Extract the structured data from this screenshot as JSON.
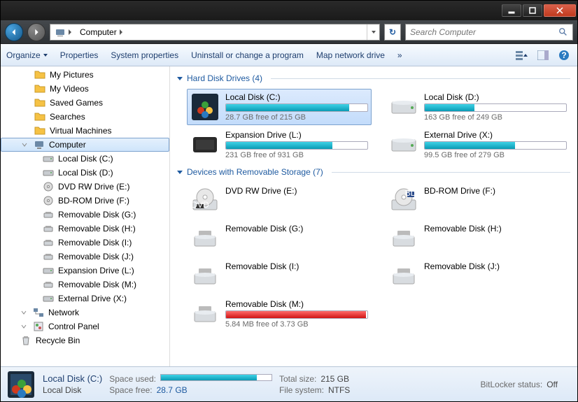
{
  "window": {
    "title": ""
  },
  "nav": {
    "address_segments": [
      "Computer"
    ],
    "search_placeholder": "Search Computer"
  },
  "toolbar": {
    "organize": "Organize",
    "properties": "Properties",
    "system_properties": "System properties",
    "uninstall": "Uninstall or change a program",
    "map_drive": "Map network drive",
    "overflow": "»"
  },
  "sidebar": {
    "items": [
      {
        "label": "My Pictures",
        "indent": 48,
        "icon": "folder"
      },
      {
        "label": "My Videos",
        "indent": 48,
        "icon": "folder"
      },
      {
        "label": "Saved Games",
        "indent": 48,
        "icon": "folder"
      },
      {
        "label": "Searches",
        "indent": 48,
        "icon": "folder"
      },
      {
        "label": "Virtual Machines",
        "indent": 48,
        "icon": "folder"
      },
      {
        "label": "Computer",
        "indent": 28,
        "icon": "computer",
        "selected": true,
        "expandable": true
      },
      {
        "label": "Local Disk (C:)",
        "indent": 60,
        "icon": "hdd"
      },
      {
        "label": "Local Disk (D:)",
        "indent": 60,
        "icon": "hdd"
      },
      {
        "label": "DVD RW Drive (E:)",
        "indent": 60,
        "icon": "optical"
      },
      {
        "label": "BD-ROM Drive (F:)",
        "indent": 60,
        "icon": "optical"
      },
      {
        "label": "Removable Disk (G:)",
        "indent": 60,
        "icon": "removable"
      },
      {
        "label": "Removable Disk (H:)",
        "indent": 60,
        "icon": "removable"
      },
      {
        "label": "Removable Disk (I:)",
        "indent": 60,
        "icon": "removable"
      },
      {
        "label": "Removable Disk (J:)",
        "indent": 60,
        "icon": "removable"
      },
      {
        "label": "Expansion Drive (L:)",
        "indent": 60,
        "icon": "hdd"
      },
      {
        "label": "Removable Disk (M:)",
        "indent": 60,
        "icon": "removable"
      },
      {
        "label": "External Drive (X:)",
        "indent": 60,
        "icon": "hdd"
      },
      {
        "label": "Network",
        "indent": 28,
        "icon": "network",
        "expandable": true
      },
      {
        "label": "Control Panel",
        "indent": 28,
        "icon": "cpanel",
        "expandable": true
      },
      {
        "label": "Recycle Bin",
        "indent": 28,
        "icon": "recycle"
      }
    ]
  },
  "groups": [
    {
      "header": "Hard Disk Drives (4)",
      "drives": [
        {
          "name": "Local Disk (C:)",
          "free": "28.7 GB free of 215 GB",
          "pct": 87,
          "color": "blue",
          "icon": "win",
          "selected": true
        },
        {
          "name": "Local Disk (D:)",
          "free": "163 GB free of 249 GB",
          "pct": 35,
          "color": "blue",
          "icon": "hdd"
        },
        {
          "name": "Expansion Drive (L:)",
          "free": "231 GB free of 931 GB",
          "pct": 75,
          "color": "blue",
          "icon": "ext"
        },
        {
          "name": "External Drive (X:)",
          "free": "99.5 GB free of 279 GB",
          "pct": 64,
          "color": "blue",
          "icon": "hdd"
        }
      ]
    },
    {
      "header": "Devices with Removable Storage (7)",
      "drives": [
        {
          "name": "DVD RW Drive (E:)",
          "icon": "dvd"
        },
        {
          "name": "BD-ROM Drive (F:)",
          "icon": "bd"
        },
        {
          "name": "Removable Disk (G:)",
          "icon": "rem"
        },
        {
          "name": "Removable Disk (H:)",
          "icon": "rem"
        },
        {
          "name": "Removable Disk (I:)",
          "icon": "rem"
        },
        {
          "name": "Removable Disk (J:)",
          "icon": "rem"
        },
        {
          "name": "Removable Disk (M:)",
          "free": "5.84 MB free of 3.73 GB",
          "pct": 99,
          "color": "red",
          "icon": "rem"
        }
      ]
    }
  ],
  "details": {
    "title": "Local Disk (C:)",
    "subtitle": "Local Disk",
    "space_used_label": "Space used:",
    "space_free_label": "Space free:",
    "space_free_value": "28.7 GB",
    "total_size_label": "Total size:",
    "total_size_value": "215 GB",
    "filesystem_label": "File system:",
    "filesystem_value": "NTFS",
    "bitlocker_label": "BitLocker status:",
    "bitlocker_value": "Off",
    "used_pct": 87
  }
}
